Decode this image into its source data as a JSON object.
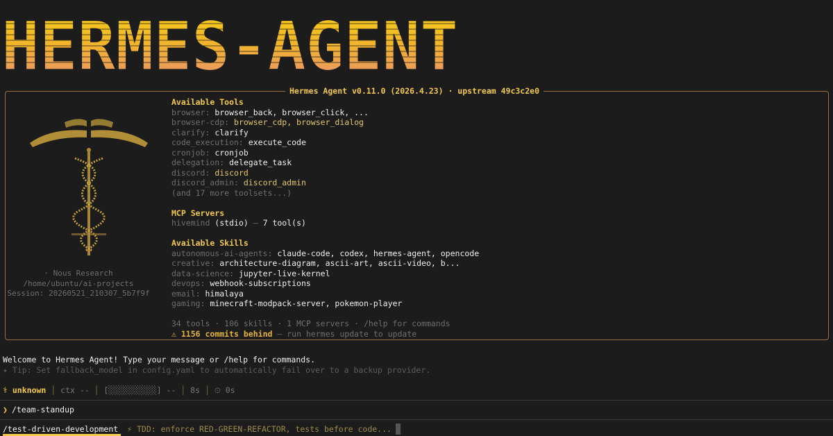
{
  "app": {
    "banner_text": "HERMES-AGENT",
    "version_title": "Hermes Agent v0.11.0 (2026.4.23) · upstream 49c3c2e0"
  },
  "info": {
    "org": "· Nous Research",
    "cwd": "/home/ubuntu/ai-projects",
    "session": "Session: 20260521_210307_5b7f9f"
  },
  "tools": {
    "heading": "Available Tools",
    "items": [
      {
        "cat": "browser:",
        "val": "browser_back, browser_click, ...",
        "style": "val"
      },
      {
        "cat": "browser-cdp:",
        "val": "browser_cdp, browser_dialog",
        "style": "val-y"
      },
      {
        "cat": "clarify:",
        "val": "clarify",
        "style": "val"
      },
      {
        "cat": "code_execution:",
        "val": "execute_code",
        "style": "val"
      },
      {
        "cat": "cronjob:",
        "val": "cronjob",
        "style": "val"
      },
      {
        "cat": "delegation:",
        "val": "delegate_task",
        "style": "val"
      },
      {
        "cat": "discord:",
        "val": "discord",
        "style": "val-y"
      },
      {
        "cat": "discord_admin:",
        "val": "discord_admin",
        "style": "val-y"
      }
    ],
    "more": "(and 17 more toolsets...)"
  },
  "mcp": {
    "heading": "MCP Servers",
    "items": [
      {
        "name": "hivemind",
        "transport": "(stdio)",
        "dash": "—",
        "count": "7 tool(s)"
      }
    ]
  },
  "skills": {
    "heading": "Available Skills",
    "items": [
      {
        "cat": "autonomous-ai-agents:",
        "val": "claude-code, codex, hermes-agent, opencode"
      },
      {
        "cat": "creative:",
        "val": "architecture-diagram, ascii-art, ascii-video, b..."
      },
      {
        "cat": "data-science:",
        "val": "jupyter-live-kernel"
      },
      {
        "cat": "devops:",
        "val": "webhook-subscriptions"
      },
      {
        "cat": "email:",
        "val": "himalaya"
      },
      {
        "cat": "gaming:",
        "val": "minecraft-modpack-server, pokemon-player"
      }
    ]
  },
  "summary": {
    "stats": "34 tools · 106 skills · 1 MCP servers · /help for commands",
    "warn_icon": "⚠",
    "warn_strong": "1156 commits behind",
    "warn_rest": "— run hermes update to update"
  },
  "welcome": "Welcome to Hermes Agent! Type your message or /help for commands.",
  "tip": "✦ Tip: Set fallback_model in config.yaml to automatically fail over to a backup provider.",
  "status": {
    "model_icon": "⚕",
    "model": "unknown",
    "ctx": "ctx --",
    "bar": "[░░░░░░░░░░]",
    "bar_value": "--",
    "elapsed": "8s",
    "timer_icon": "⏲",
    "timer": "0s"
  },
  "prompt": {
    "chevron": "❯",
    "input": "/team-standup"
  },
  "suggestion": {
    "command": "/test-driven-development",
    "icon": "⚡",
    "hint": "TDD: enforce RED-GREEN-REFACTOR, tests before code..."
  },
  "colors": {
    "accent": "#f2c94c",
    "banner_top": "#f5c518",
    "banner_bottom": "#e8987a",
    "border": "#9a7040"
  }
}
